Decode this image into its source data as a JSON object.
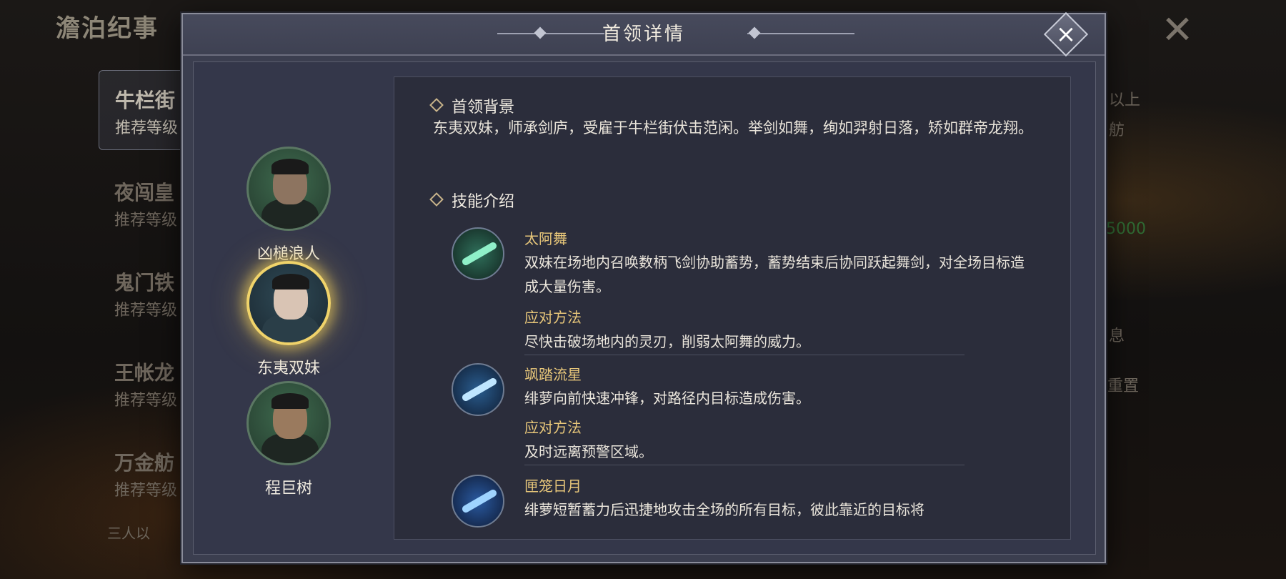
{
  "background": {
    "title": "澹泊纪事",
    "list": [
      {
        "name": "牛栏街",
        "level": "推荐等级",
        "active": true
      },
      {
        "name": "夜闯皇",
        "level": "推荐等级"
      },
      {
        "name": "鬼门铁",
        "level": "推荐等级"
      },
      {
        "name": "王帐龙",
        "level": "推荐等级"
      },
      {
        "name": "万金舫",
        "level": "推荐等级"
      }
    ],
    "note": "三人以",
    "right_texts": [
      "以上",
      "舫",
      "5000",
      "息",
      "重置"
    ]
  },
  "modal": {
    "title": "首领详情",
    "bosses": [
      {
        "name": "凶槌浪人",
        "selected": false
      },
      {
        "name": "东夷双妹",
        "selected": true
      },
      {
        "name": "程巨树",
        "selected": false
      }
    ],
    "background_section": {
      "heading": "首领背景",
      "text": "东夷双妹，师承剑庐，受雇于牛栏街伏击范闲。举剑如舞，绚如羿射日落，矫如群帝龙翔。"
    },
    "skills_section": {
      "heading": "技能介绍",
      "skills": [
        {
          "name": "太阿舞",
          "description": "双妹在场地内召唤数柄飞剑协助蓄势，蓄势结束后协同跃起舞剑，对全场目标造成大量伤害。",
          "counter_label": "应对方法",
          "counter": "尽快击破场地内的灵刃，削弱太阿舞的威力。",
          "icon": "sword-dance-icon"
        },
        {
          "name": "飒踏流星",
          "description": "绯萝向前快速冲锋，对路径内目标造成伤害。",
          "counter_label": "应对方法",
          "counter": "及时远离预警区域。",
          "icon": "dash-icon"
        },
        {
          "name": "匣笼日月",
          "description": "绯萝短暂蓄力后迅捷地攻击全场的所有目标，彼此靠近的目标将",
          "icon": "strike-icon"
        }
      ]
    }
  },
  "colors": {
    "accent_gold": "#e8c77a",
    "selected_glow": "#f0d36a",
    "panel_bg": "#3b3e4f"
  }
}
